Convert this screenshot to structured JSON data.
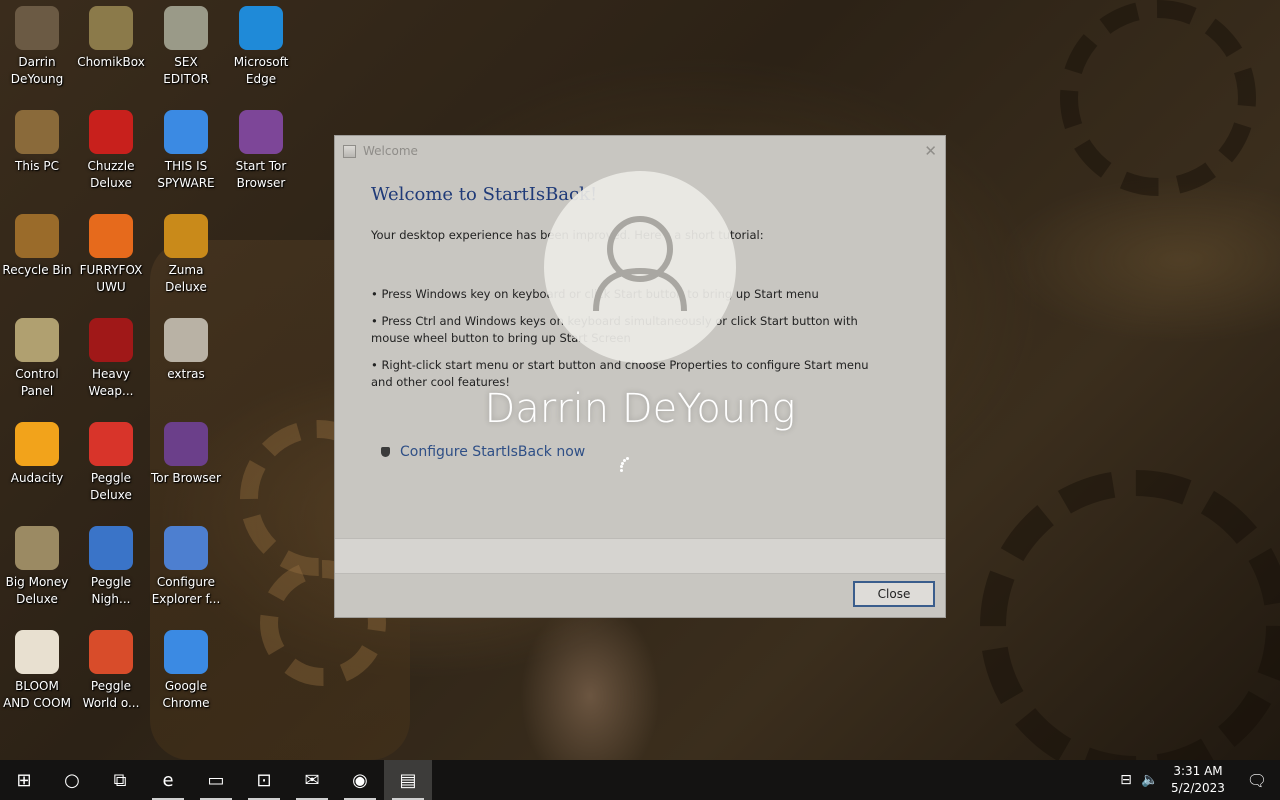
{
  "desktop": {
    "icons": [
      {
        "label": "Darrin\nDeYoung",
        "icon": "user-folder-icon",
        "color": "#6b5a44"
      },
      {
        "label": "ChomikBox",
        "icon": "chomikbox-icon",
        "color": "#8b7a4a"
      },
      {
        "label": "SEX\nEDITOR",
        "icon": "hex-editor-icon",
        "color": "#9a9a88"
      },
      {
        "label": "Microsoft\nEdge",
        "icon": "edge-icon",
        "color": "#1f8ad8"
      },
      {
        "label": "This PC",
        "icon": "computer-icon",
        "color": "#8a6a3a"
      },
      {
        "label": "Chuzzle\nDeluxe",
        "icon": "chuzzle-icon",
        "color": "#c8201c"
      },
      {
        "label": "THIS IS\nSPYWARE",
        "icon": "chrome-icon",
        "color": "#3b8ae3"
      },
      {
        "label": "Start Tor\nBrowser",
        "icon": "tor-icon",
        "color": "#7d4698"
      },
      {
        "label": "Recycle Bin",
        "icon": "recycle-bin-icon",
        "color": "#9a6b2a"
      },
      {
        "label": "FURRYFOX\nUWU",
        "icon": "firefox-icon",
        "color": "#e66a1c"
      },
      {
        "label": "Zuma Deluxe",
        "icon": "zuma-icon",
        "color": "#c98a1a"
      },
      {
        "label": "Control\nPanel",
        "icon": "control-panel-icon",
        "color": "#b0a070"
      },
      {
        "label": "Heavy\nWeap...",
        "icon": "radiation-icon",
        "color": "#a01818"
      },
      {
        "label": "extras",
        "icon": "extras-icon",
        "color": "#b9b2a5"
      },
      {
        "label": "Audacity",
        "icon": "audacity-icon",
        "color": "#f2a31b"
      },
      {
        "label": "Peggle\nDeluxe",
        "icon": "peggle-icon",
        "color": "#d8342a"
      },
      {
        "label": "Tor Browser",
        "icon": "tor-icon",
        "color": "#6b3f8a"
      },
      {
        "label": "Big Money\nDeluxe",
        "icon": "money-bag-icon",
        "color": "#9b8a63"
      },
      {
        "label": "Peggle\nNigh...",
        "icon": "peggle-icon",
        "color": "#3a74c8"
      },
      {
        "label": "Configure\nExplorer f...",
        "icon": "shield-folder-icon",
        "color": "#4d7fd0"
      },
      {
        "label": "BLOOM\nAND COOM",
        "icon": "flower-icon",
        "color": "#e8e0d0"
      },
      {
        "label": "Peggle\nWorld o...",
        "icon": "peggle-icon",
        "color": "#d84c2a"
      },
      {
        "label": "Google\nChrome",
        "icon": "chrome-icon",
        "color": "#3b8ae3"
      }
    ]
  },
  "dialog": {
    "title": "Welcome",
    "heading": "Welcome to StartIsBack!",
    "intro": "Your desktop experience has been improved. Here's a short tutorial:",
    "bullets": [
      "• Press Windows key on keyboard or click Start button to bring up Start menu",
      "• Press Ctrl and Windows keys on keyboard simultaneously or click Start button with mouse wheel button to bring up Start Screen",
      "• Right-click start menu or start button and choose Properties to configure Start menu and other cool features!"
    ],
    "configure_link": "Configure StartIsBack now",
    "close_button": "Close",
    "close_glyph": "✕"
  },
  "login_overlay": {
    "user_name": "Darrin DeYoung"
  },
  "taskbar": {
    "buttons": [
      {
        "name": "start-button",
        "glyph": "⊞"
      },
      {
        "name": "search-button",
        "glyph": "○"
      },
      {
        "name": "task-view-button",
        "glyph": "⧉"
      },
      {
        "name": "taskbar-edge-button",
        "glyph": "e"
      },
      {
        "name": "taskbar-file-explorer-button",
        "glyph": "▭"
      },
      {
        "name": "taskbar-store-button",
        "glyph": "⊡"
      },
      {
        "name": "taskbar-mail-button",
        "glyph": "✉"
      },
      {
        "name": "taskbar-chrome-button",
        "glyph": "◉"
      },
      {
        "name": "taskbar-welcome-app-button",
        "glyph": "▤"
      }
    ],
    "tray": {
      "network_glyph": "⊟",
      "volume_glyph": "🔈",
      "time": "3:31 AM",
      "date": "5/2/2023",
      "notification_glyph": "🗨"
    }
  }
}
